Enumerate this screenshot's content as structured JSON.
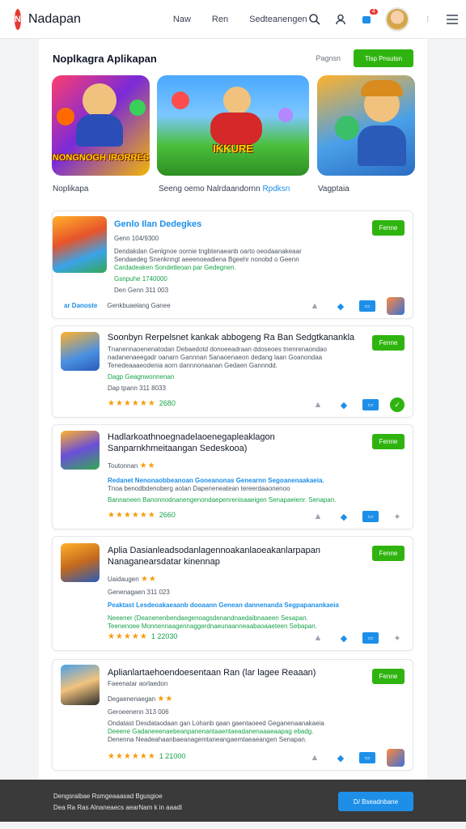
{
  "header": {
    "logo_text": "N",
    "brand": "Nadapan",
    "nav": [
      "Naw",
      "Ren",
      "Sedteanengen"
    ],
    "notification_count": "4"
  },
  "section": {
    "title": "Noplkagra Aplikapan",
    "link": "Pagnsn",
    "button": "Tlsp Pnsutsn"
  },
  "featured": [
    {
      "art_title": "NONGNOGH IRORRES",
      "caption": "Noplikapa"
    },
    {
      "art_title": "IKKURE",
      "caption": "Seeng oemo Nalrdaandornn",
      "caption_link": "Rpdksn"
    },
    {
      "art_title": "",
      "caption": "Vagptaia"
    }
  ],
  "cards": [
    {
      "title": "Genlo Ilan Dedegkes",
      "meta": "Genn 104/9300",
      "desc1": "Dendakdan Genlgnoe oornie tngbtenaeanb oarto oeodaanakeaar",
      "desc2": "Sendaedeg Snenknngt aeeenoeadiena Bgeehr nonobd o Geenn",
      "desc3": "Cardadeaken Sondetleoan par Gedegnen.",
      "green1": "Gsnpuhe 1740000",
      "line5": "Den Genn 311 003",
      "foot_link": "ar Danoste",
      "foot_text": "Genkbuaelang Ganee",
      "get": "Fenne"
    },
    {
      "title": "Soonbyn Rerpelsnet kankak abbogeng Ra Ban Sedgtkanankla",
      "desc1": "Tnanennaoenenatodan Debaedotd donoeeadraan ddoseoes tnenrenaondao",
      "desc2": "nadanenaeegadr oanarn Gannnan Sanaoenaeon dedang laan Goanondaa",
      "desc3": "Tenedeaaaeodenia aorn dannnonaanan Gedaen Gannndd.",
      "green1": "Dagp Geagnwonnenan",
      "line5": "Dap tpann 311 8033",
      "rating_num": "2680",
      "get": "Fenne"
    },
    {
      "title": "Hadlarkoathnoegnadelaoenegapleaklagon Sanparnkhmeitaangan Sedeskooa)",
      "meta": "Toutonnan",
      "desc1": "Redanet Nenonaobbeanoan Goneanonas Genearnn Segoanenaakaeia.",
      "desc2": "Tnoa benodbdenoberg aotan Dapeneneatean tereerdaaonenoo",
      "desc3": "Bannaneen Banonnodnanengenondaepenrenisaaeigen Senapaeienr. Senapan.",
      "rating_num": "2660",
      "get": "Fenne"
    },
    {
      "title": "Aplia Dasianleadsodanlagennoakanlaoeakanlarpapan Nanaganearsdatar kinennap",
      "meta": "Uaidaugen",
      "line5": "Genenagaen 311 023",
      "desc1": "Peaktast Lesdeoakaeaanb dooaann Genean dannenanda Segpapanankaeia",
      "desc2": "Neeener (Deanenenbendaegenoagsdenandnaedaibnaaeen Sesapan.",
      "desc3": "Teenenoee Monnennaagennaggerdnaeunaanneaabaoaaeteen Sebapan.",
      "rating_num": "1 22030",
      "get": "Fenne"
    },
    {
      "title": "Aplianlartaehoendoesentaan Ran (lar lagee Reaaan)",
      "meta": "Faeenatar aorlaedon",
      "line3": "Degaenenaegan",
      "line4": "Geroeenenn 313 006",
      "desc1": "Ondatast Desdataodaan gan Lohanb qaan gaentaoeed Geganenaanakaeia",
      "desc2": "Deeene Gadaneeenaebeanpanenantaaentaeadanenaaaeaapag ebadg.",
      "desc3": "Denenna Neadeahaanbaeanagemtaneangaemtaeaeangen Senapan.",
      "rating_num": "1 21000",
      "get": "Fenne"
    }
  ],
  "bottom": {
    "line1": "Dengsraibae Rsmgeaaasad Bgusgioe",
    "line2": "Dea Ra Ras Alnaneaecs aearNam k in aaadl",
    "button": "D/ Bseadnbane"
  },
  "colors": {
    "accent_green": "#2fb40f",
    "accent_blue": "#1d8fe8",
    "logo_red": "#e53935",
    "star": "#f59e0b"
  }
}
